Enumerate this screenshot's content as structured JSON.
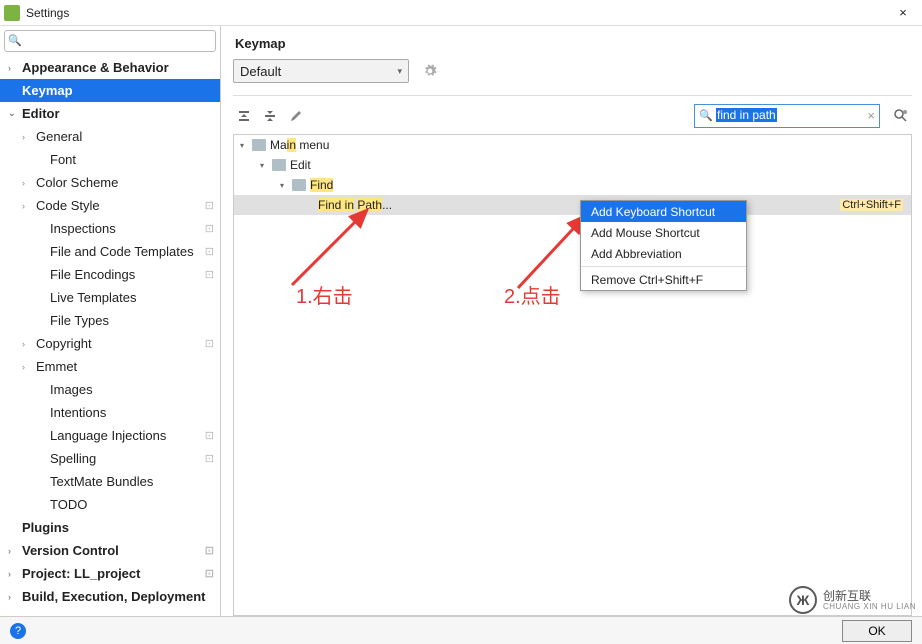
{
  "window": {
    "title": "Settings",
    "close": "×"
  },
  "sidebar": {
    "search_placeholder": "",
    "items": [
      {
        "label": "Appearance & Behavior",
        "bold": true,
        "chev": "›",
        "indent": 0
      },
      {
        "label": "Keymap",
        "bold": true,
        "selected": true,
        "indent": 0
      },
      {
        "label": "Editor",
        "bold": true,
        "chev": "⌄",
        "indent": 0
      },
      {
        "label": "General",
        "chev": "›",
        "indent": 1
      },
      {
        "label": "Font",
        "indent": 2
      },
      {
        "label": "Color Scheme",
        "chev": "›",
        "indent": 1
      },
      {
        "label": "Code Style",
        "chev": "›",
        "indent": 1,
        "cfg": true
      },
      {
        "label": "Inspections",
        "indent": 2,
        "cfg": true
      },
      {
        "label": "File and Code Templates",
        "indent": 2,
        "cfg": true
      },
      {
        "label": "File Encodings",
        "indent": 2,
        "cfg": true
      },
      {
        "label": "Live Templates",
        "indent": 2
      },
      {
        "label": "File Types",
        "indent": 2
      },
      {
        "label": "Copyright",
        "chev": "›",
        "indent": 1,
        "cfg": true
      },
      {
        "label": "Emmet",
        "chev": "›",
        "indent": 1
      },
      {
        "label": "Images",
        "indent": 2
      },
      {
        "label": "Intentions",
        "indent": 2
      },
      {
        "label": "Language Injections",
        "indent": 2,
        "cfg": true
      },
      {
        "label": "Spelling",
        "indent": 2,
        "cfg": true
      },
      {
        "label": "TextMate Bundles",
        "indent": 2
      },
      {
        "label": "TODO",
        "indent": 2
      },
      {
        "label": "Plugins",
        "bold": true,
        "indent": 0
      },
      {
        "label": "Version Control",
        "bold": true,
        "chev": "›",
        "indent": 0,
        "cfg": true
      },
      {
        "label": "Project: LL_project",
        "bold": true,
        "chev": "›",
        "indent": 0,
        "cfg": true
      },
      {
        "label": "Build, Execution, Deployment",
        "bold": true,
        "chev": "›",
        "indent": 0
      }
    ]
  },
  "content": {
    "title": "Keymap",
    "scheme": "Default",
    "filter_value": "find in path",
    "tree": {
      "main_menu": "Main menu",
      "edit": "Edit",
      "find": "Find",
      "find_in_path": "Find in Path...",
      "shortcut": "Ctrl+Shift+F"
    }
  },
  "context_menu": [
    {
      "label": "Add Keyboard Shortcut",
      "sel": true
    },
    {
      "label": "Add Mouse Shortcut"
    },
    {
      "label": "Add Abbreviation"
    },
    {
      "sep": true
    },
    {
      "label": "Remove Ctrl+Shift+F"
    }
  ],
  "annotations": {
    "a1": "1.右击",
    "a2": "2.点击"
  },
  "footer": {
    "ok": "OK"
  },
  "watermark": {
    "logo": "Ж",
    "text": "创新互联",
    "sub": "CHUANG XIN HU LIAN"
  }
}
